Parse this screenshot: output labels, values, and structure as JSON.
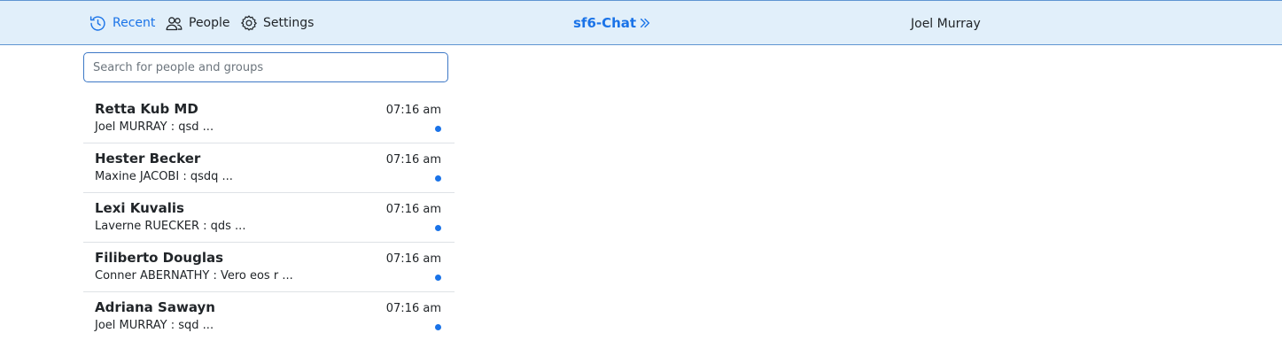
{
  "nav": {
    "recent_label": "Recent",
    "people_label": "People",
    "settings_label": "Settings"
  },
  "brand": {
    "name": "sf6-Chat"
  },
  "user": {
    "name": "Joel Murray"
  },
  "search": {
    "placeholder": "Search for people and groups",
    "value": ""
  },
  "conversations": [
    {
      "name": "Retta Kub MD",
      "preview": "Joel MURRAY : qsd ...",
      "time": "07:16 am"
    },
    {
      "name": "Hester Becker",
      "preview": "Maxine JACOBI : qsdq ...",
      "time": "07:16 am"
    },
    {
      "name": "Lexi Kuvalis",
      "preview": "Laverne RUECKER : qds ...",
      "time": "07:16 am"
    },
    {
      "name": "Filiberto Douglas",
      "preview": "Conner ABERNATHY : Vero eos r ...",
      "time": "07:16 am"
    },
    {
      "name": "Adriana Sawayn",
      "preview": "Joel MURRAY : sqd ...",
      "time": "07:16 am"
    }
  ],
  "colors": {
    "accent": "#1a73e8",
    "header_bg": "#e1effa",
    "header_border": "#5f95d2"
  },
  "icons": {
    "recent": "clock-icon",
    "people": "people-icon",
    "settings": "gear-icon",
    "brand": "double-chevron-right-icon",
    "unread": "unread-dot-icon"
  }
}
